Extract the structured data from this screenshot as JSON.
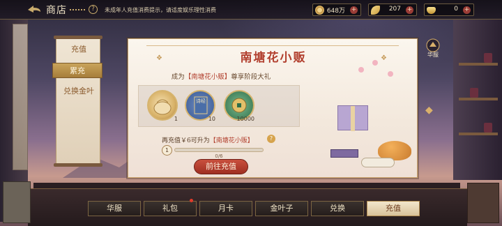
{
  "top_bar": {
    "title": "商店",
    "notice": "未成年人充值消费提示，请适度娱乐理性消费",
    "resources": [
      {
        "icon": "copper-coin-icon",
        "value": "648万"
      },
      {
        "icon": "gold-leaf-icon",
        "value": "207"
      },
      {
        "icon": "gold-ingot-icon",
        "value": "0"
      }
    ]
  },
  "sidebar": {
    "items": [
      {
        "label": "充值",
        "active": false
      },
      {
        "label": "累充",
        "active": true
      },
      {
        "label": "兑换金叶",
        "active": false
      }
    ]
  },
  "panel": {
    "title": "南塘花小贩",
    "subtitle_prefix": "成为",
    "subtitle_rank": "【南塘花小贩】",
    "subtitle_suffix": "尊享阶段大礼",
    "rewards": [
      {
        "icon": "sachet-icon",
        "count": "1"
      },
      {
        "icon": "book-icon",
        "count": "10",
        "label": "诗经"
      },
      {
        "icon": "copper-coin-icon",
        "count": "10000"
      }
    ],
    "condition_prefix": "再充值￥6可升为",
    "condition_rank": "【南塘花小贩】",
    "level": "1",
    "progress_text": "0/6",
    "progress_fraction": 0,
    "button": "前往充值"
  },
  "side_right": {
    "costume_label": "华服"
  },
  "bottom_tabs": [
    {
      "label": "华服",
      "active": false
    },
    {
      "label": "礼包",
      "active": false
    },
    {
      "label": "月卡",
      "active": false
    },
    {
      "label": "金叶子",
      "active": false
    },
    {
      "label": "兑换",
      "active": false
    },
    {
      "label": "充值",
      "active": true
    }
  ],
  "colors": {
    "accent_red": "#b2402f",
    "gold": "#c9a45b"
  }
}
